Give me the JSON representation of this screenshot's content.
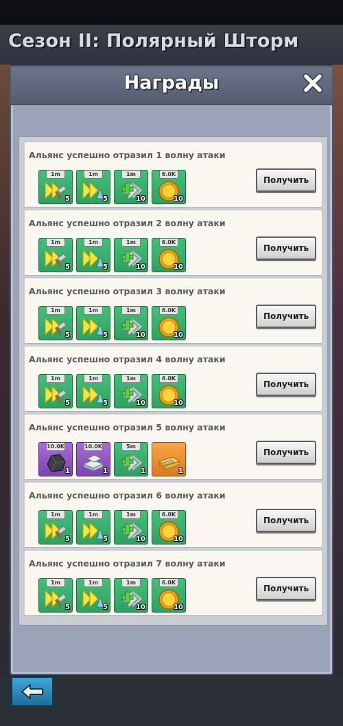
{
  "season_title": "Сезон II: Полярный Шторм",
  "panel_title": "Награды",
  "claim_label": "Получить",
  "rewards": [
    {
      "title": "Альянс успешно отразил 1 волну атаки",
      "items": [
        {
          "type": "speedup-build",
          "tag": "1m",
          "count": "5"
        },
        {
          "type": "speedup-research",
          "tag": "1m",
          "count": "5"
        },
        {
          "type": "speedup-heal",
          "tag": "1m",
          "count": "10"
        },
        {
          "type": "gold-coin",
          "tag": "6.0K",
          "count": "10"
        }
      ]
    },
    {
      "title": "Альянс успешно отразил 2 волну атаки",
      "items": [
        {
          "type": "speedup-build",
          "tag": "1m",
          "count": "5"
        },
        {
          "type": "speedup-research",
          "tag": "1m",
          "count": "5"
        },
        {
          "type": "speedup-heal",
          "tag": "1m",
          "count": "10"
        },
        {
          "type": "gold-coin",
          "tag": "6.0K",
          "count": "10"
        }
      ]
    },
    {
      "title": "Альянс успешно отразил 3 волну атаки",
      "items": [
        {
          "type": "speedup-build",
          "tag": "1m",
          "count": "5"
        },
        {
          "type": "speedup-research",
          "tag": "1m",
          "count": "5"
        },
        {
          "type": "speedup-heal",
          "tag": "1m",
          "count": "10"
        },
        {
          "type": "gold-coin",
          "tag": "6.0K",
          "count": "10"
        }
      ]
    },
    {
      "title": "Альянс успешно отразил 4 волну атаки",
      "items": [
        {
          "type": "speedup-build",
          "tag": "1m",
          "count": "5"
        },
        {
          "type": "speedup-research",
          "tag": "1m",
          "count": "5"
        },
        {
          "type": "speedup-heal",
          "tag": "1m",
          "count": "10"
        },
        {
          "type": "gold-coin",
          "tag": "6.0K",
          "count": "10"
        }
      ]
    },
    {
      "title": "Альянс успешно отразил 5 волну атаки",
      "items": [
        {
          "type": "coal",
          "tag": "10.0K",
          "count": "1"
        },
        {
          "type": "iron",
          "tag": "10.0K",
          "count": "1"
        },
        {
          "type": "speedup-heal",
          "tag": "5m",
          "count": "1"
        },
        {
          "type": "gold-bars",
          "tag": "",
          "count": "1"
        }
      ]
    },
    {
      "title": "Альянс успешно отразил 6 волну атаки",
      "items": [
        {
          "type": "speedup-build",
          "tag": "1m",
          "count": "5"
        },
        {
          "type": "speedup-research",
          "tag": "1m",
          "count": "5"
        },
        {
          "type": "speedup-heal",
          "tag": "1m",
          "count": "10"
        },
        {
          "type": "gold-coin",
          "tag": "6.0K",
          "count": "10"
        }
      ]
    },
    {
      "title": "Альянс успешно отразил 7 волну атаки",
      "items": [
        {
          "type": "speedup-build",
          "tag": "1m",
          "count": "5"
        },
        {
          "type": "speedup-research",
          "tag": "1m",
          "count": "5"
        },
        {
          "type": "speedup-heal",
          "tag": "1m",
          "count": "10"
        },
        {
          "type": "gold-coin",
          "tag": "6.0K",
          "count": "10"
        }
      ]
    }
  ],
  "icons": {
    "close": "close-icon",
    "back": "back-arrow-icon"
  }
}
